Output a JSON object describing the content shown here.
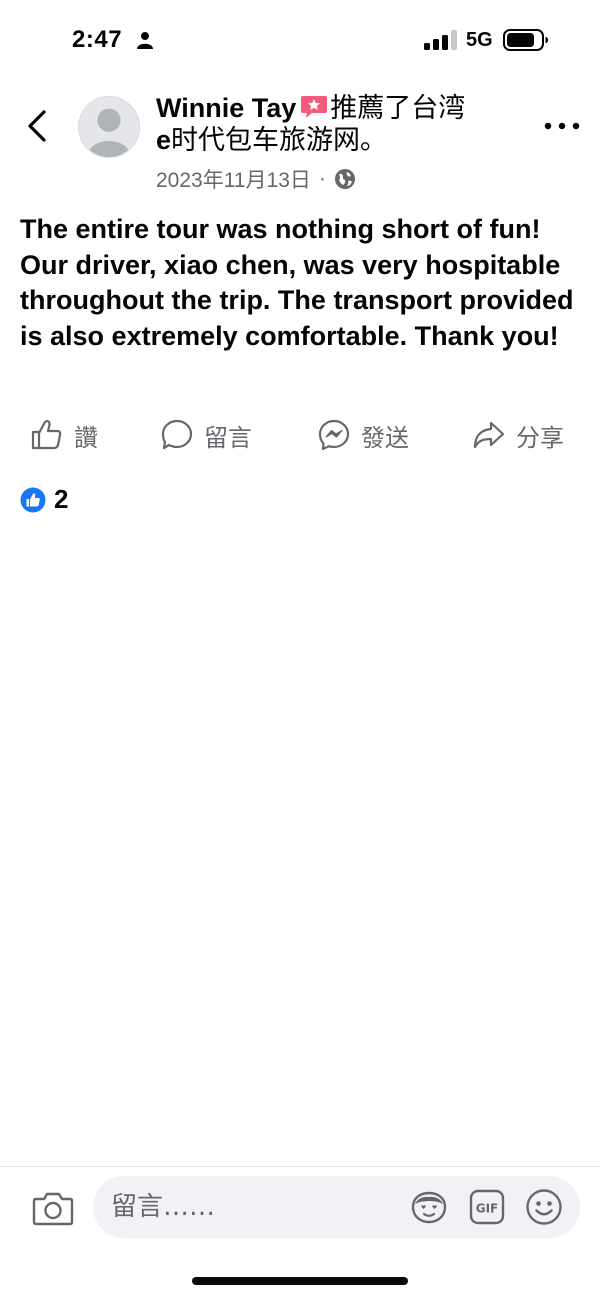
{
  "status_bar": {
    "time": "2:47",
    "network": "5G"
  },
  "post": {
    "author": "Winnie Tay",
    "action_text_first": "推薦了台湾",
    "page_name_prefix": "e",
    "page_name_rest": "时代包车旅游网。",
    "date": "2023年11月13日",
    "meta_separator": "·",
    "body": "The entire tour was nothing short of fun! Our driver, xiao chen, was very hospitable throughout the trip. The transport provided is also extremely comfortable. Thank you!",
    "reaction_count": "2"
  },
  "actions": {
    "like_label": "讚",
    "comment_label": "留言",
    "send_label": "發送",
    "share_label": "分享"
  },
  "comment_bar": {
    "placeholder": "留言……"
  },
  "colors": {
    "text_primary": "#050505",
    "text_secondary": "#65676b",
    "facebook_blue": "#1877f2",
    "recommend_pink": "#f25c7a",
    "input_background": "#f0f2f5"
  },
  "icons": {
    "back": "chevron-left-icon",
    "more": "more-horizontal-icon",
    "audience": "globe-icon",
    "recommend": "recommend-badge-icon",
    "like": "thumbs-up-icon",
    "comment": "speech-bubble-icon",
    "send": "messenger-icon",
    "share": "share-arrow-icon",
    "camera": "camera-icon",
    "avatar_sticker": "avatar-sticker-icon",
    "gif": "gif-icon",
    "emoji": "emoji-icon"
  }
}
